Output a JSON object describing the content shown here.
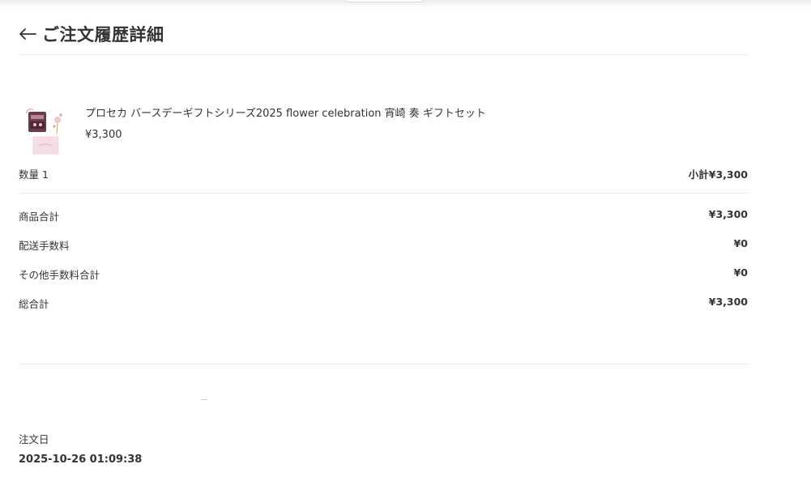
{
  "header": {
    "title": "ご注文履歴詳細",
    "back_icon": "arrow-left-icon"
  },
  "item": {
    "name": "プロセカ バースデーギフトシリーズ2025 flower celebration 宵崎 奏 ギフトセット",
    "price": "¥3,300",
    "quantity_label": "数量 1",
    "subtotal_label": "小計¥3,300"
  },
  "summary": [
    {
      "label": "商品合計",
      "value": "¥3,300"
    },
    {
      "label": "配送手数料",
      "value": "¥0"
    },
    {
      "label": "その他手数料合計",
      "value": "¥0"
    },
    {
      "label": "総合計",
      "value": "¥3,300"
    }
  ],
  "order": {
    "date_label": "注文日",
    "date_value": "2025-10-26 01:09:38"
  },
  "colors": {
    "text": "#333333",
    "divider": "#e6e6e6",
    "thumb_box": "#6b3b4a",
    "thumb_card": "#f6dce4"
  }
}
